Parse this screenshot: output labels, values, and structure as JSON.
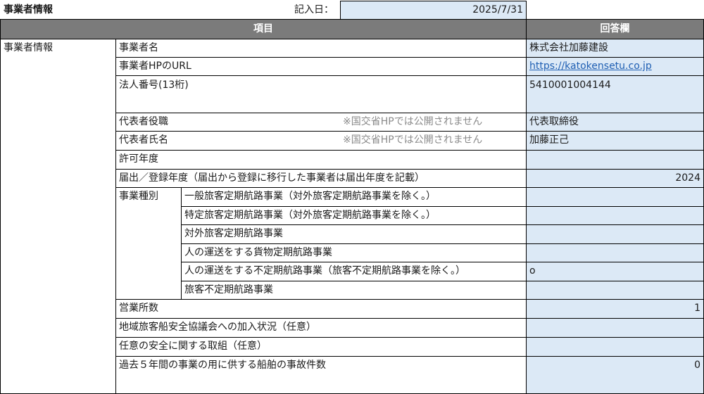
{
  "title": "事業者情報",
  "date_label": "記入日：",
  "date_value": "2025/7/31",
  "header": {
    "item": "項目",
    "answer": "回答欄"
  },
  "section": "事業者情報",
  "rows": {
    "name": {
      "label": "事業者名",
      "value": "株式会社加藤建設"
    },
    "url": {
      "label": "事業者HPのURL",
      "value": "https://katokensetu.co.jp"
    },
    "corp": {
      "label": "法人番号(13桁)",
      "value": "5410001004144"
    },
    "rep_title": {
      "label": "代表者役職",
      "note": "※国交省HPでは公開されません",
      "value": "代表取締役"
    },
    "rep_name": {
      "label": "代表者氏名",
      "note": "※国交省HPでは公開されません",
      "value": "加藤正己"
    },
    "permit_year": {
      "label": "許可年度",
      "value": ""
    },
    "reg_year": {
      "label": "届出／登録年度（届出から登録に移行した事業者は届出年度を記載）",
      "value": "2024"
    },
    "business_type_label": "事業種別",
    "types": [
      {
        "label": "一般旅客定期航路事業（対外旅客定期航路事業を除く。）",
        "value": ""
      },
      {
        "label": "特定旅客定期航路事業（対外旅客定期航路事業を除く。）",
        "value": ""
      },
      {
        "label": "対外旅客定期航路事業",
        "value": ""
      },
      {
        "label": "人の運送をする貨物定期航路事業",
        "value": ""
      },
      {
        "label": "人の運送をする不定期航路事業（旅客不定期航路事業を除く。）",
        "value": "o"
      },
      {
        "label": "旅客不定期航路事業",
        "value": ""
      }
    ],
    "offices": {
      "label": "営業所数",
      "value": "1"
    },
    "council": {
      "label": "地域旅客船安全協議会への加入状況（任意）",
      "value": ""
    },
    "safety": {
      "label": "任意の安全に関する取組（任意）",
      "value": ""
    },
    "accidents": {
      "label": "過去５年間の事業の用に供する船舶の事故件数",
      "value": "0"
    }
  }
}
